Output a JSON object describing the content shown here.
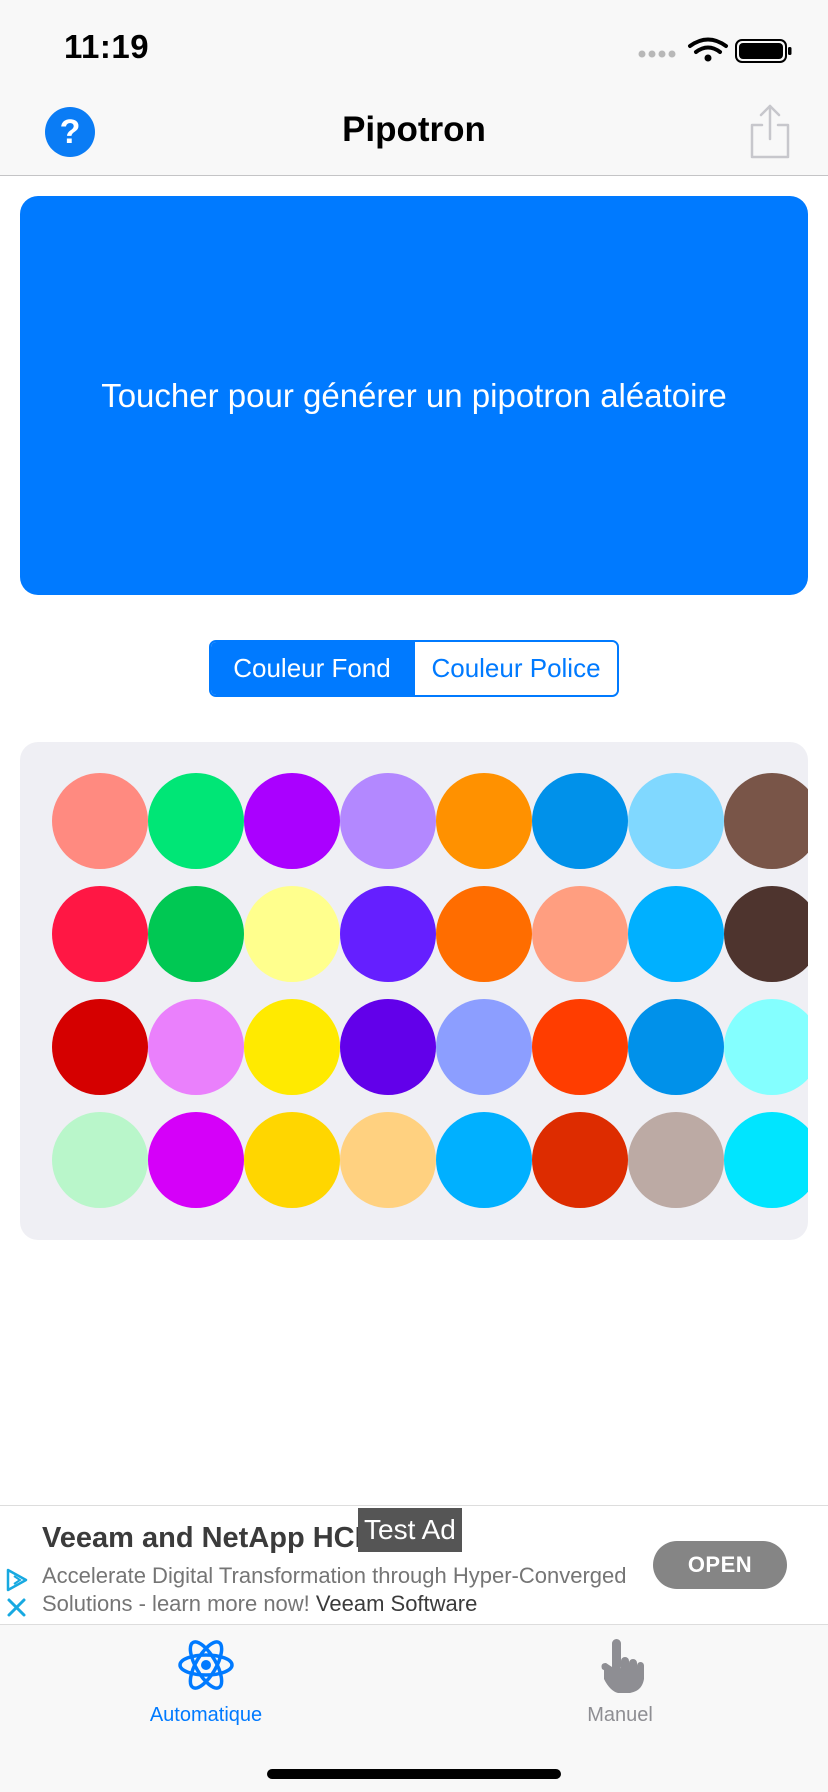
{
  "status_bar": {
    "time": "11:19"
  },
  "nav": {
    "title": "Pipotron",
    "help_label": "?",
    "help_icon": "question-circle-icon",
    "share_icon": "share-icon"
  },
  "main": {
    "generate_text": "Toucher pour générer un pipotron aléatoire",
    "accent": "#007aff"
  },
  "segmented": {
    "options": [
      "Couleur Fond",
      "Couleur Police"
    ],
    "selected": "Couleur Fond"
  },
  "palette": {
    "rows": [
      [
        "#ff8a80",
        "#00e676",
        "#aa00ff",
        "#b388ff",
        "#ff9100",
        "#0091ea",
        "#80d8ff",
        "#795548"
      ],
      [
        "#ff1744",
        "#00c853",
        "#ffff8d",
        "#651fff",
        "#ff6d00",
        "#ff9e80",
        "#00b0ff",
        "#4e342e"
      ],
      [
        "#d50000",
        "#ea80fc",
        "#ffea00",
        "#6200ea",
        "#8c9eff",
        "#ff3d00",
        "#0091ea",
        "#84ffff"
      ],
      [
        "#b9f6ca",
        "#d500f9",
        "#ffd600",
        "#ffd180",
        "#00b0ff",
        "#dd2c00",
        "#bcaaa4",
        "#00e5ff"
      ]
    ]
  },
  "ad": {
    "title": "Veeam and NetApp HCI",
    "tag": "Test Ad",
    "description": "Accelerate Digital Transformation through Hyper-Converged Solutions - learn more now!",
    "advertiser": "Veeam Software",
    "cta": "OPEN"
  },
  "tabbar": {
    "tabs": [
      {
        "label": "Automatique",
        "icon": "atom-icon",
        "active": true
      },
      {
        "label": "Manuel",
        "icon": "hand-pointer-icon",
        "active": false
      }
    ]
  }
}
